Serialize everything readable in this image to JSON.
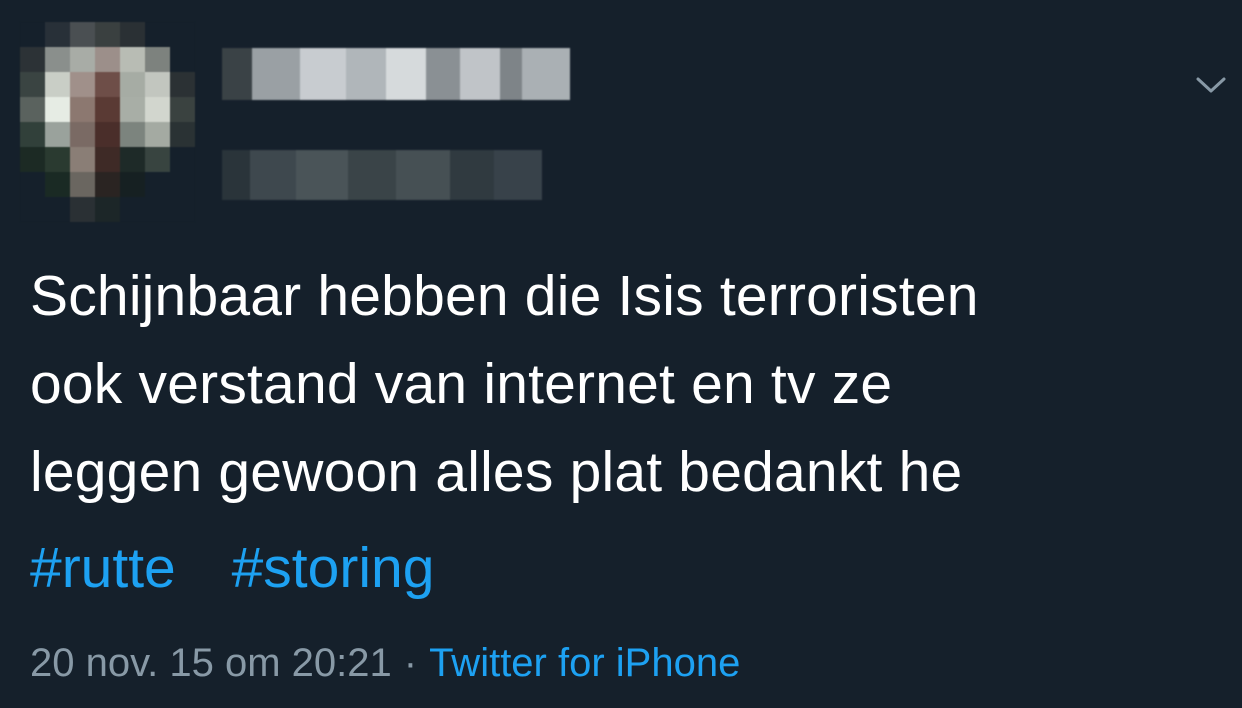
{
  "author": {
    "avatar_icon": "pixelated-avatar",
    "name_redacted": "",
    "handle_redacted": ""
  },
  "tweet": {
    "text_lines": [
      "Schijnbaar hebben die Isis terroristen",
      "ook verstand van internet en tv ze",
      "leggen gewoon alles plat bedankt he"
    ],
    "hashtags": [
      "#rutte",
      "#storing"
    ],
    "timestamp": "20 nov. 15 om 20:21",
    "separator": "·",
    "source": "Twitter for iPhone"
  },
  "menu": {
    "icon": "chevron-down-icon"
  },
  "colors": {
    "background": "#15202b",
    "text": "#ffffff",
    "link": "#1da1f2",
    "muted": "#8899a6"
  }
}
